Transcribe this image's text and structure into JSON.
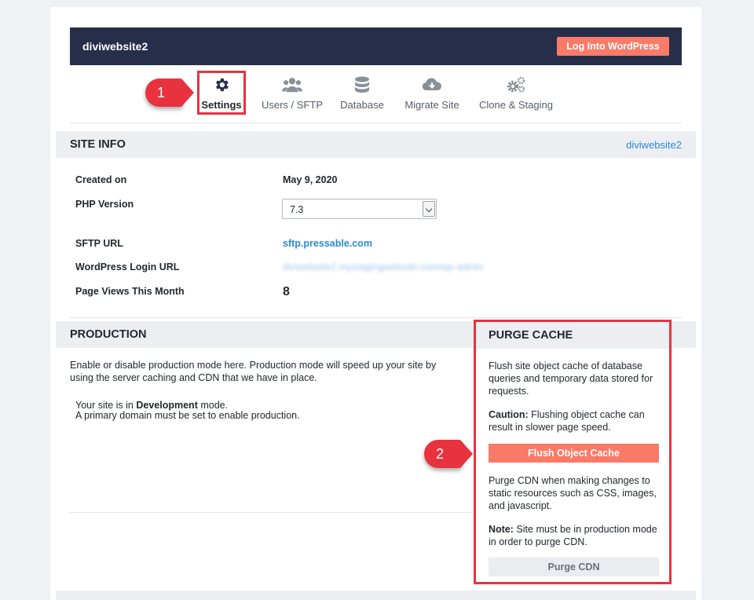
{
  "header": {
    "site_name": "diviwebsite2",
    "login_button": "Log Into WordPress"
  },
  "tabs": [
    {
      "label": "Settings",
      "icon": "gear-icon",
      "active": true
    },
    {
      "label": "Users / SFTP",
      "icon": "users-icon",
      "active": false
    },
    {
      "label": "Database",
      "icon": "database-icon",
      "active": false
    },
    {
      "label": "Migrate Site",
      "icon": "cloud-download-icon",
      "active": false
    },
    {
      "label": "Clone & Staging",
      "icon": "gears-icon",
      "active": false
    }
  ],
  "annotations": {
    "badge1": "1",
    "badge2": "2"
  },
  "site_info": {
    "title": "SITE INFO",
    "site_link": "diviwebsite2",
    "rows": {
      "created_label": "Created on",
      "created_value": "May 9, 2020",
      "php_label": "PHP Version",
      "php_value": "7.3",
      "sftp_label": "SFTP URL",
      "sftp_value": "sftp.pressable.com",
      "wp_login_label": "WordPress Login URL",
      "wp_login_value": "diviwebsite2.mystagingwebsite.com/wp-admin",
      "pageviews_label": "Page Views This Month",
      "pageviews_value": "8"
    }
  },
  "production": {
    "title": "PRODUCTION",
    "description": "Enable or disable production mode here. Production mode will speed up your site by using the server caching and CDN that we have in place.",
    "status_prefix": "Your site is in ",
    "status_mode": "Development",
    "status_suffix": " mode.",
    "note": "A primary domain must be set to enable production."
  },
  "purge_cache": {
    "title": "PURGE CACHE",
    "flush_desc": "Flush site object cache of database queries and temporary data stored for requests.",
    "caution_label": "Caution:",
    "caution_text": " Flushing object cache can result in slower page speed.",
    "flush_button": "Flush Object Cache",
    "cdn_desc": "Purge CDN when making changes to static resources such as CSS, images, and javascript.",
    "note_label": "Note:",
    "note_text": " Site must be in production mode in order to purge CDN.",
    "cdn_button": "Purge CDN"
  },
  "colors": {
    "navy": "#272e49",
    "accent": "#f97a67",
    "highlight": "#e8323e",
    "link": "#2b8bd4"
  }
}
